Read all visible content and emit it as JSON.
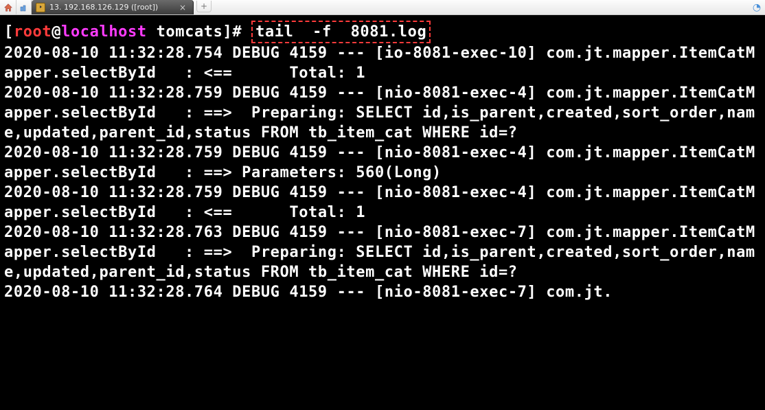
{
  "tab": {
    "title": "13. 192.168.126.129 ([root])"
  },
  "prompt": {
    "user": "root",
    "at": "@",
    "host": "localhost",
    "dir": "tomcats",
    "open": "[",
    "close": "]",
    "end": "# "
  },
  "command": {
    "bin": "tail",
    "flag": "-f",
    "file": "8081.log"
  },
  "log_lines": [
    {
      "ts": "2020-08-10 11:32:28.754 DEBUG 4159 ",
      "sep": "---",
      "thread": " [io-8081-exec-10] ",
      "rest": "com.jt.mapper.ItemCatMapper.selectById   : <==      Total: 1"
    },
    {
      "ts": "2020-08-10 11:32:28.759 DEBUG 4159 ",
      "sep": "---",
      "thread": " [nio-8081-exec-4] ",
      "rest": "com.jt.mapper.ItemCatMapper.selectById   : ==>  Preparing: SELECT id,is_parent,created,sort_order,name,updated,parent_id,status FROM tb_item_cat WHERE id=?"
    },
    {
      "ts": "2020-08-10 11:32:28.759 DEBUG 4159 ",
      "sep": "---",
      "thread": " [nio-8081-exec-4] ",
      "rest": "com.jt.mapper.ItemCatMapper.selectById   : ==> Parameters: 560(Long)"
    },
    {
      "ts": "2020-08-10 11:32:28.759 DEBUG 4159 ",
      "sep": "---",
      "thread": " [nio-8081-exec-4] ",
      "rest": "com.jt.mapper.ItemCatMapper.selectById   : <==      Total: 1"
    },
    {
      "ts": "2020-08-10 11:32:28.763 DEBUG 4159 ",
      "sep": "---",
      "thread": " [nio-8081-exec-7] ",
      "rest": "com.jt.mapper.ItemCatMapper.selectById   : ==>  Preparing: SELECT id,is_parent,created,sort_order,name,updated,parent_id,status FROM tb_item_cat WHERE id=?"
    },
    {
      "ts": "2020-08-10 11:32:28.764 DEBUG 4159 ",
      "sep": "---",
      "thread": " [nio-8081-exec-7] ",
      "rest": "com.jt."
    }
  ]
}
